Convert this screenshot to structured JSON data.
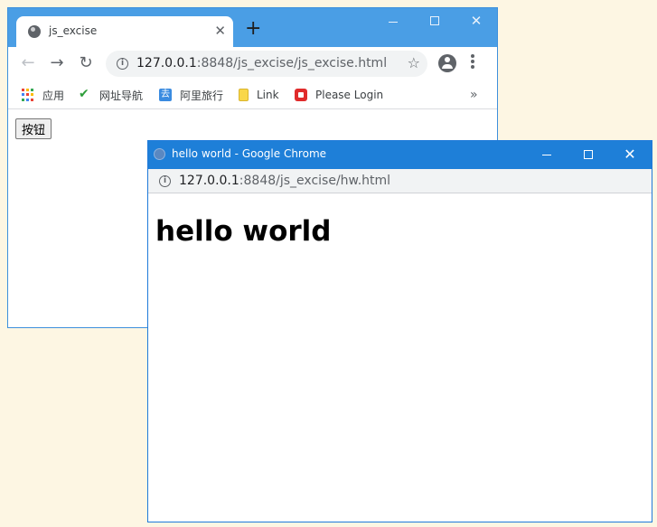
{
  "main_window": {
    "tab": {
      "title": "js_excise",
      "close_glyph": "✕",
      "favicon": "globe-icon"
    },
    "new_tab_glyph": "+",
    "window_controls": {
      "close_glyph": "✕"
    },
    "toolbar": {
      "back_glyph": "←",
      "forward_glyph": "→",
      "reload_glyph": "↻",
      "url_host": "127.0.0.1",
      "url_rest": ":8848/js_excise/js_excise.html",
      "info_glyph": "i",
      "star_glyph": "☆"
    },
    "bookmarks": [
      {
        "label": "应用",
        "icon": "apps-grid-icon"
      },
      {
        "label": "网址导航",
        "icon": "hao-icon"
      },
      {
        "label": "阿里旅行",
        "icon": "ali-travel-icon"
      },
      {
        "label": "Link",
        "icon": "folder-icon"
      },
      {
        "label": "Please Login",
        "icon": "login-icon"
      }
    ],
    "bookmarks_more_glyph": "»",
    "page": {
      "button_label": "按钮"
    }
  },
  "popup_window": {
    "title": "hello world - Google Chrome",
    "close_glyph": "✕",
    "url_host": "127.0.0.1",
    "url_rest": ":8848/js_excise/hw.html",
    "info_glyph": "i",
    "page": {
      "heading": "hello world"
    }
  },
  "colors": {
    "desktop": "#fdf6e3",
    "main_titlebar": "#4a9ee5",
    "popup_titlebar": "#1e7fd8",
    "apps_grid": [
      "#ea4335",
      "#fbbc05",
      "#34a853",
      "#4285f4",
      "#ea4335",
      "#fbbc05",
      "#34a853",
      "#4285f4",
      "#ea4335"
    ]
  }
}
